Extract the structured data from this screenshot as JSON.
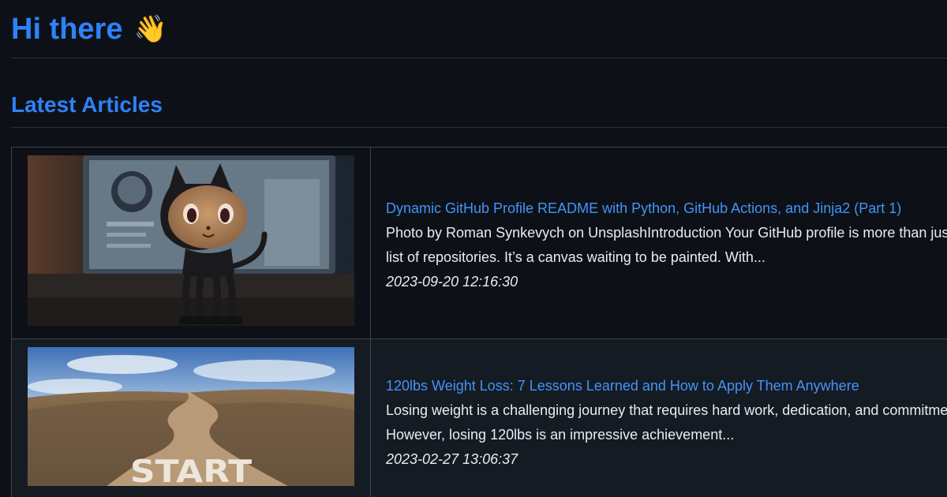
{
  "header": {
    "title": "Hi there",
    "emoji": "👋"
  },
  "section": {
    "title": "Latest Articles"
  },
  "articles": [
    {
      "title": "Dynamic GitHub Profile README with Python, GitHub Actions, and Jinja2 (Part 1)",
      "excerpt": "Photo by Roman Synkevych on UnsplashIntroduction Your GitHub profile is more than just a list of repositories. It’s a canvas waiting to be painted. With...",
      "date": "2023-09-20 12:16:30",
      "image": "octocat-figurine-photo"
    },
    {
      "title": "120lbs Weight Loss: 7 Lessons Learned and How to Apply Them Anywhere",
      "excerpt": "Losing weight is a challenging journey that requires hard work, dedication, and commitment. However, losing 120lbs is an impressive achievement...",
      "date": "2023-02-27 13:06:37",
      "image": "start-road-photo"
    }
  ],
  "colors": {
    "background": "#0d1117",
    "heading": "#2f81f7",
    "link": "#4493f8",
    "text": "#e6edf3",
    "border": "#3d444d"
  }
}
